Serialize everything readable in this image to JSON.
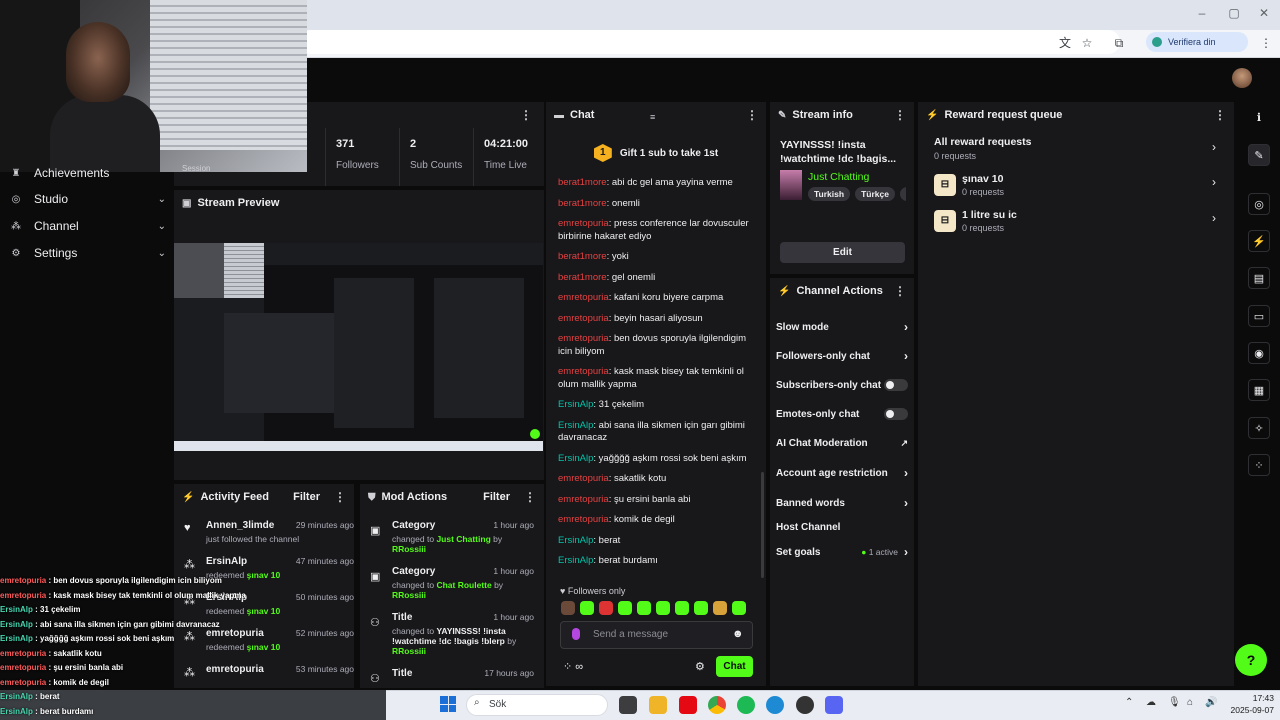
{
  "browser": {
    "verify_label": "Verifiera din identitet"
  },
  "webcam": {
    "partial_label": "Session"
  },
  "nav": {
    "items": [
      {
        "label": "Achievements",
        "icon": "trophy-icon"
      },
      {
        "label": "Studio",
        "icon": "studio-icon"
      },
      {
        "label": "Channel",
        "icon": "channel-icon"
      },
      {
        "label": "Settings",
        "icon": "gear-icon"
      }
    ]
  },
  "stats": [
    {
      "value": "371",
      "label": "Followers"
    },
    {
      "value": "2",
      "label": "Sub Counts"
    },
    {
      "value": "04:21:00",
      "label": "Time Live"
    }
  ],
  "preview": {
    "title": "Stream Preview"
  },
  "chat": {
    "title": "Chat",
    "gift_label": "Gift 1 sub to take 1st",
    "gift_coin": "1",
    "messages": [
      {
        "user": "berat1more",
        "kind": "r",
        "text": "abi dc gel ama yayina verme"
      },
      {
        "user": "berat1more",
        "kind": "r",
        "text": "onemli"
      },
      {
        "user": "emretopuria",
        "kind": "r",
        "text": "press conference lar dovusculer birbirine hakaret ediyo"
      },
      {
        "user": "berat1more",
        "kind": "r",
        "text": "yoki"
      },
      {
        "user": "berat1more",
        "kind": "r",
        "text": "gel onemli"
      },
      {
        "user": "emretopuria",
        "kind": "r",
        "text": "kafani koru biyere carpma"
      },
      {
        "user": "emretopuria",
        "kind": "r",
        "text": "beyin hasari aliyosun"
      },
      {
        "user": "emretopuria",
        "kind": "r",
        "text": "ben dovus sporuyla ilgilendigim icin biliyom"
      },
      {
        "user": "emretopuria",
        "kind": "r",
        "text": "kask mask bisey tak temkinli ol olum mallik yapma"
      },
      {
        "user": "ErsinAlp",
        "kind": "g",
        "text": "31 çekelim"
      },
      {
        "user": "ErsinAlp",
        "kind": "g",
        "text": "abi sana illa sikmen için garı gibimi davranacaz"
      },
      {
        "user": "ErsinAlp",
        "kind": "g",
        "text": "yağğğğ aşkım rossi sok beni aşkım"
      },
      {
        "user": "emretopuria",
        "kind": "r",
        "text": "sakatlik kotu"
      },
      {
        "user": "emretopuria",
        "kind": "r",
        "text": "şu ersini banla abi"
      },
      {
        "user": "emretopuria",
        "kind": "r",
        "text": "komik de degil"
      },
      {
        "user": "ErsinAlp",
        "kind": "g",
        "text": "berat"
      },
      {
        "user": "ErsinAlp",
        "kind": "g",
        "text": "berat burdamı"
      }
    ],
    "followers_only": "Followers only",
    "placeholder": "Send a message",
    "send_label": "Chat"
  },
  "stream_info": {
    "title": "Stream info",
    "stream_title": "YAYINSSS! !insta !watchtime !dc !bagis...",
    "category": "Just Chatting",
    "tags": [
      "Turkish",
      "Türkçe",
      "s"
    ],
    "edit_label": "Edit"
  },
  "channel_actions": {
    "title": "Channel Actions",
    "rows": [
      {
        "label": "Slow mode",
        "control": "chevron"
      },
      {
        "label": "Followers-only chat",
        "control": "chevron"
      },
      {
        "label": "Subscribers-only chat",
        "control": "toggle"
      },
      {
        "label": "Emotes-only chat",
        "control": "toggle"
      },
      {
        "label": "AI Chat Moderation",
        "control": "external"
      },
      {
        "label": "Account age restriction",
        "control": "chevron"
      },
      {
        "label": "Banned words",
        "control": "chevron"
      },
      {
        "label": "Host Channel",
        "control": "none"
      },
      {
        "label": "Set goals",
        "control": "chevron",
        "badge": "1 active"
      }
    ]
  },
  "rewards": {
    "title": "Reward request queue",
    "all_label": "All reward requests",
    "all_count": "0 requests",
    "items": [
      {
        "label": "şınav 10",
        "count": "0 requests"
      },
      {
        "label": "1 litre su ic",
        "count": "0 requests"
      }
    ]
  },
  "activity": {
    "title": "Activity Feed",
    "filter": "Filter",
    "items": [
      {
        "who": "Annen_3limde",
        "time": "29 minutes ago",
        "sub": "just followed the channel",
        "icon": "heart-icon"
      },
      {
        "who": "ErsinAlp",
        "time": "47 minutes ago",
        "sub": "redeemed",
        "reward": "şınav 10",
        "icon": "reward-icon"
      },
      {
        "who": "ErsinAlp",
        "time": "50 minutes ago",
        "sub": "redeemed",
        "reward": "şınav 10",
        "icon": "reward-icon"
      },
      {
        "who": "emretopuria",
        "time": "52 minutes ago",
        "sub": "redeemed",
        "reward": "şınav 10",
        "icon": "reward-icon"
      },
      {
        "who": "emretopuria",
        "time": "53 minutes ago",
        "sub": "",
        "icon": "reward-icon"
      }
    ]
  },
  "mod_actions": {
    "title": "Mod Actions",
    "filter": "Filter",
    "items": [
      {
        "what": "Category",
        "time": "1 hour ago",
        "pre": "changed to",
        "value": "Just Chatting",
        "by": "by",
        "mod": "RRossiii"
      },
      {
        "what": "Category",
        "time": "1 hour ago",
        "pre": "changed to",
        "value": "Chat Roulette",
        "by": "by",
        "mod": "RRossiii"
      },
      {
        "what": "Title",
        "time": "1 hour ago",
        "pre": "changed to",
        "value": "YAYINSSS! !insta !watchtime !dc !bagis !blerp",
        "by": "by",
        "mod": "RRossiii"
      },
      {
        "what": "Title",
        "time": "17 hours ago",
        "pre": "",
        "value": "",
        "by": "",
        "mod": ""
      }
    ]
  },
  "overlay_chat": [
    {
      "user": "emretopuria",
      "kind": "r",
      "text": "ben dovus sporuyla ilgilendigim icin biliyom"
    },
    {
      "user": "emretopuria",
      "kind": "r",
      "text": "kask mask bisey tak temkinli ol olum mallik yapma"
    },
    {
      "user": "ErsinAlp",
      "kind": "g",
      "text": "31 çekelim"
    },
    {
      "user": "ErsinAlp",
      "kind": "g",
      "text": "abi sana illa sikmen için garı gibimi davranacaz"
    },
    {
      "user": "ErsinAlp",
      "kind": "g",
      "text": "yağğğğ aşkım rossi sok beni aşkım"
    },
    {
      "user": "emretopuria",
      "kind": "r",
      "text": "sakatlik kotu"
    },
    {
      "user": "emretopuria",
      "kind": "r",
      "text": "şu ersini banla abi"
    },
    {
      "user": "emretopuria",
      "kind": "r",
      "text": "komik de degil"
    },
    {
      "user": "ErsinAlp",
      "kind": "g",
      "text": "berat"
    },
    {
      "user": "ErsinAlp",
      "kind": "g",
      "text": "berat burdamı"
    }
  ],
  "taskbar": {
    "search_label": "Sök",
    "time": "17:43",
    "date": "2025-09-07"
  },
  "colors": {
    "accent": "#53fc18",
    "panel": "#18181b",
    "chat_red": "#e64141",
    "chat_teal": "#00c4a8"
  }
}
